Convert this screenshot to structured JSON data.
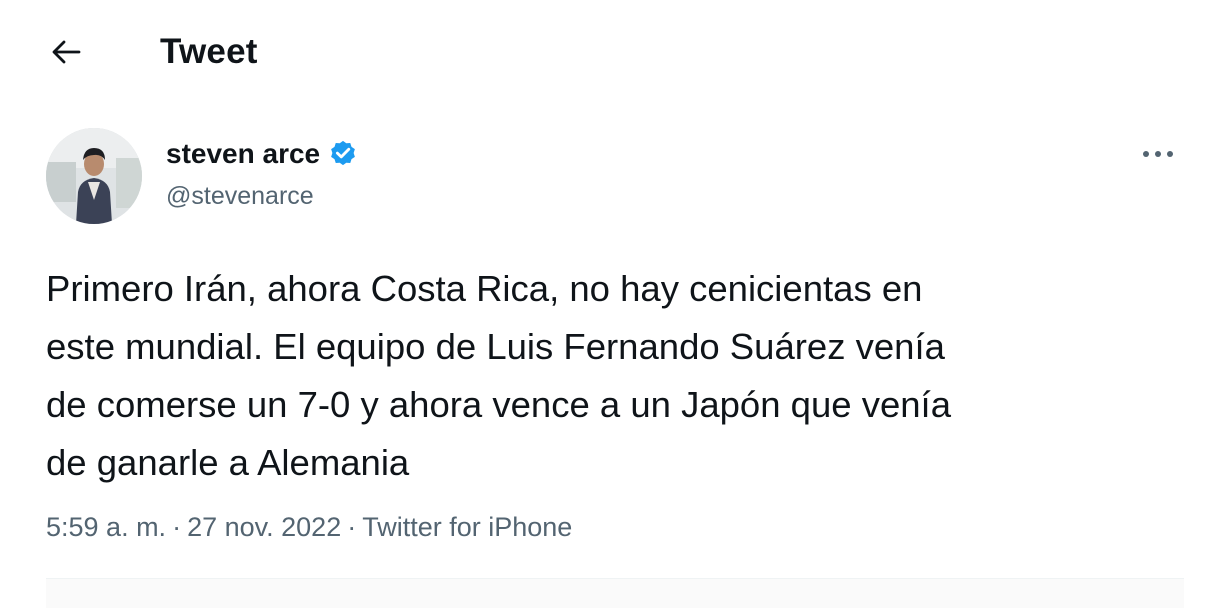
{
  "header": {
    "back_icon": "arrow-left-icon",
    "title": "Tweet"
  },
  "author": {
    "avatar_icon": "profile-photo",
    "display_name": "steven arce",
    "verified_icon": "verified-badge-icon",
    "verified_color": "#1d9bf0",
    "handle": "@stevenarce",
    "more_icon": "more-horizontal-icon"
  },
  "tweet": {
    "text": "Primero Irán, ahora Costa Rica, no hay cenicientas en\neste mundial. El equipo de Luis Fernando Suárez venía\nde comerse un 7-0 y ahora vence a un Japón que venía\nde ganarle a Alemania"
  },
  "meta": {
    "time": "5:59 a. m.",
    "sep1": "·",
    "date": "27 nov. 2022",
    "sep2": "·",
    "source": "Twitter for iPhone"
  },
  "colors": {
    "text_primary": "#0f1419",
    "text_secondary": "#536471",
    "divider": "#eff3f4"
  }
}
